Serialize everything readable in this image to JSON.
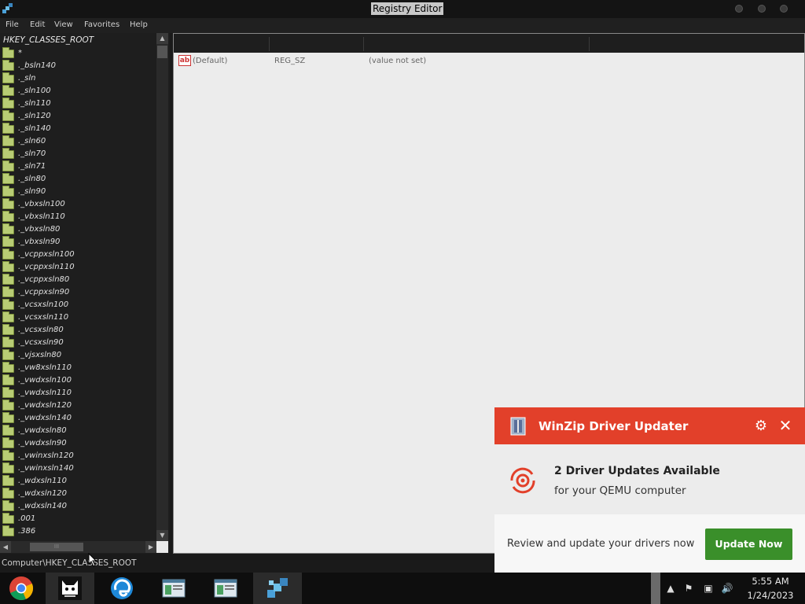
{
  "window": {
    "title": "Registry Editor"
  },
  "menu": [
    "File",
    "Edit",
    "View",
    "Favorites",
    "Help"
  ],
  "tree": {
    "root": "HKEY_CLASSES_ROOT",
    "items": [
      "*",
      "._bsln140",
      "._sln",
      "._sln100",
      "._sln110",
      "._sln120",
      "._sln140",
      "._sln60",
      "._sln70",
      "._sln71",
      "._sln80",
      "._sln90",
      "._vbxsln100",
      "._vbxsln110",
      "._vbxsln80",
      "._vbxsln90",
      "._vcppxsln100",
      "._vcppxsln110",
      "._vcppxsln80",
      "._vcppxsln90",
      "._vcsxsln100",
      "._vcsxsln110",
      "._vcsxsln80",
      "._vcsxsln90",
      "._vjsxsln80",
      "._vw8xsln110",
      "._vwdxsln100",
      "._vwdxsln110",
      "._vwdxsln120",
      "._vwdxsln140",
      "._vwdxsln80",
      "._vwdxsln90",
      "._vwinxsln120",
      "._vwinxsln140",
      "._wdxsln110",
      "._wdxsln120",
      "._wdxsln140",
      ".001",
      ".386"
    ]
  },
  "scrollbar": {
    "hthumb_grip": "III"
  },
  "values": [
    {
      "name": "(Default)",
      "type": "REG_SZ",
      "data": "(value not set)",
      "icon": "ab-icon"
    }
  ],
  "status": {
    "path": "Computer\\HKEY_CLASSES_ROOT"
  },
  "notification": {
    "title": "WinZip Driver Updater",
    "headline": "2 Driver Updates Available",
    "subtext": "for your QEMU computer",
    "footer_text": "Review and update your drivers now",
    "button": "Update Now",
    "accent": "#e2402a",
    "button_color": "#3a8f2a"
  },
  "taskbar": {
    "items": [
      "chrome-icon",
      "cat-app-icon",
      "edge-icon",
      "window-app-icon",
      "window-app-icon",
      "regedit-icon"
    ],
    "clock_time": "5:55 AM",
    "clock_date": "1/24/2023"
  }
}
